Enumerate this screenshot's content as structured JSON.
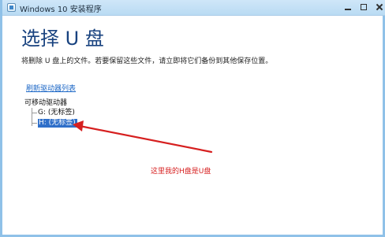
{
  "window": {
    "title": "Windows 10 安装程序"
  },
  "content": {
    "heading": "选择 U 盘",
    "description": "将删除 U 盘上的文件。若要保留这些文件，请立即将它们备份到其他保存位置。",
    "refresh_link": "刷新驱动器列表"
  },
  "drives": {
    "group_label": "可移动驱动器",
    "items": [
      {
        "label": "G: (无标签)"
      },
      {
        "label": "H: (无标签)"
      }
    ]
  },
  "annotation": {
    "text": "这里我的H盘是U盘",
    "color": "#d61f1f"
  },
  "colors": {
    "accent": "#18427f",
    "link": "#1c67c6",
    "selection": "#2f6fc9",
    "frame": "#8fc1e8"
  },
  "icons": {
    "app": "setup-app-icon",
    "minimize": "minimize-icon",
    "maximize": "maximize-icon",
    "close": "close-icon"
  }
}
